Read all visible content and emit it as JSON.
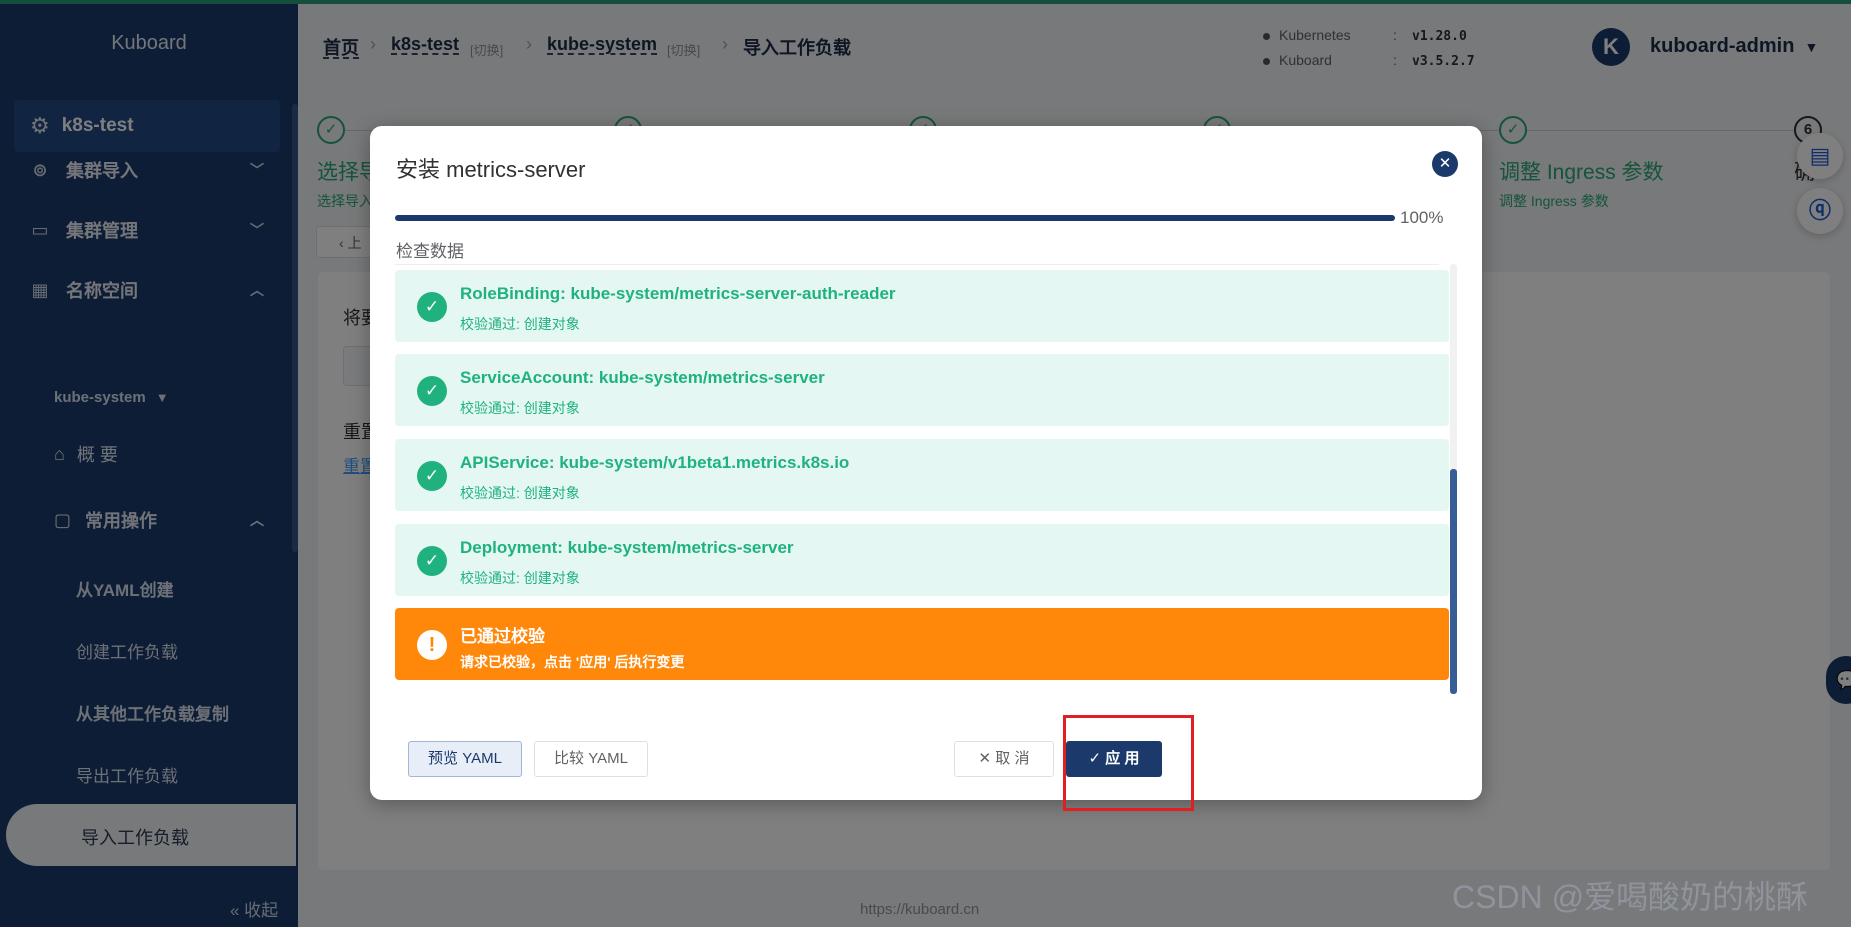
{
  "sidebar": {
    "brand": "Kuboard",
    "cluster": "k8s-test",
    "menu": {
      "import": "集群导入",
      "manage": "集群管理",
      "namespace": "名称空间"
    },
    "namespace_selected": "kube-system",
    "overview": "概 要",
    "common_ops": "常用操作",
    "items": [
      "从YAML创建",
      "创建工作负载",
      "从其他工作负载复制",
      "导出工作负载",
      "导入工作负载"
    ],
    "collapse": "« 收起"
  },
  "header": {
    "breadcrumb": {
      "home": "首页",
      "cluster": "k8s-test",
      "switch1": "[切换]",
      "namespace": "kube-system",
      "switch2": "[切换]",
      "current": "导入工作负载"
    },
    "versions": [
      {
        "name": "Kubernetes",
        "value": "v1.28.0"
      },
      {
        "name": "Kuboard",
        "value": "v3.5.2.7"
      }
    ],
    "avatar_letter": "K",
    "user": "kuboard-admin"
  },
  "background": {
    "step1_title": "选择导",
    "step1_sub": "选择导入",
    "step5_title": "调整 Ingress 参数",
    "step5_sub": "调整 Ingress 参数",
    "step6_num": "6",
    "step6_title": "确",
    "back_label": "上",
    "card_line1": "将要",
    "card_line2": "重置",
    "card_line3": "重置"
  },
  "modal": {
    "title": "安装 metrics-server",
    "progress": 100,
    "progress_text": "100%",
    "section_label": "检查数据",
    "items": [
      {
        "title": "RoleBinding: kube-system/metrics-server-auth-reader",
        "status": "校验通过: 创建对象"
      },
      {
        "title": "ServiceAccount: kube-system/metrics-server",
        "status": "校验通过: 创建对象"
      },
      {
        "title": "APIService: kube-system/v1beta1.metrics.k8s.io",
        "status": "校验通过: 创建对象"
      },
      {
        "title": "Deployment: kube-system/metrics-server",
        "status": "校验通过: 创建对象"
      }
    ],
    "warning": {
      "title": "已通过校验",
      "message": "请求已校验，点击 '应用' 后执行变更"
    },
    "buttons": {
      "preview": "预览 YAML",
      "compare": "比较 YAML",
      "cancel": "✕ 取 消",
      "apply": "✓ 应 用"
    }
  },
  "footer": "https://kuboard.cn",
  "watermark": "CSDN @爱喝酸奶的桃酥",
  "colors": {
    "sidebar": "#1b3a6b",
    "success": "#1fb27f",
    "warning": "#ff880b",
    "highlight": "#e02020"
  }
}
